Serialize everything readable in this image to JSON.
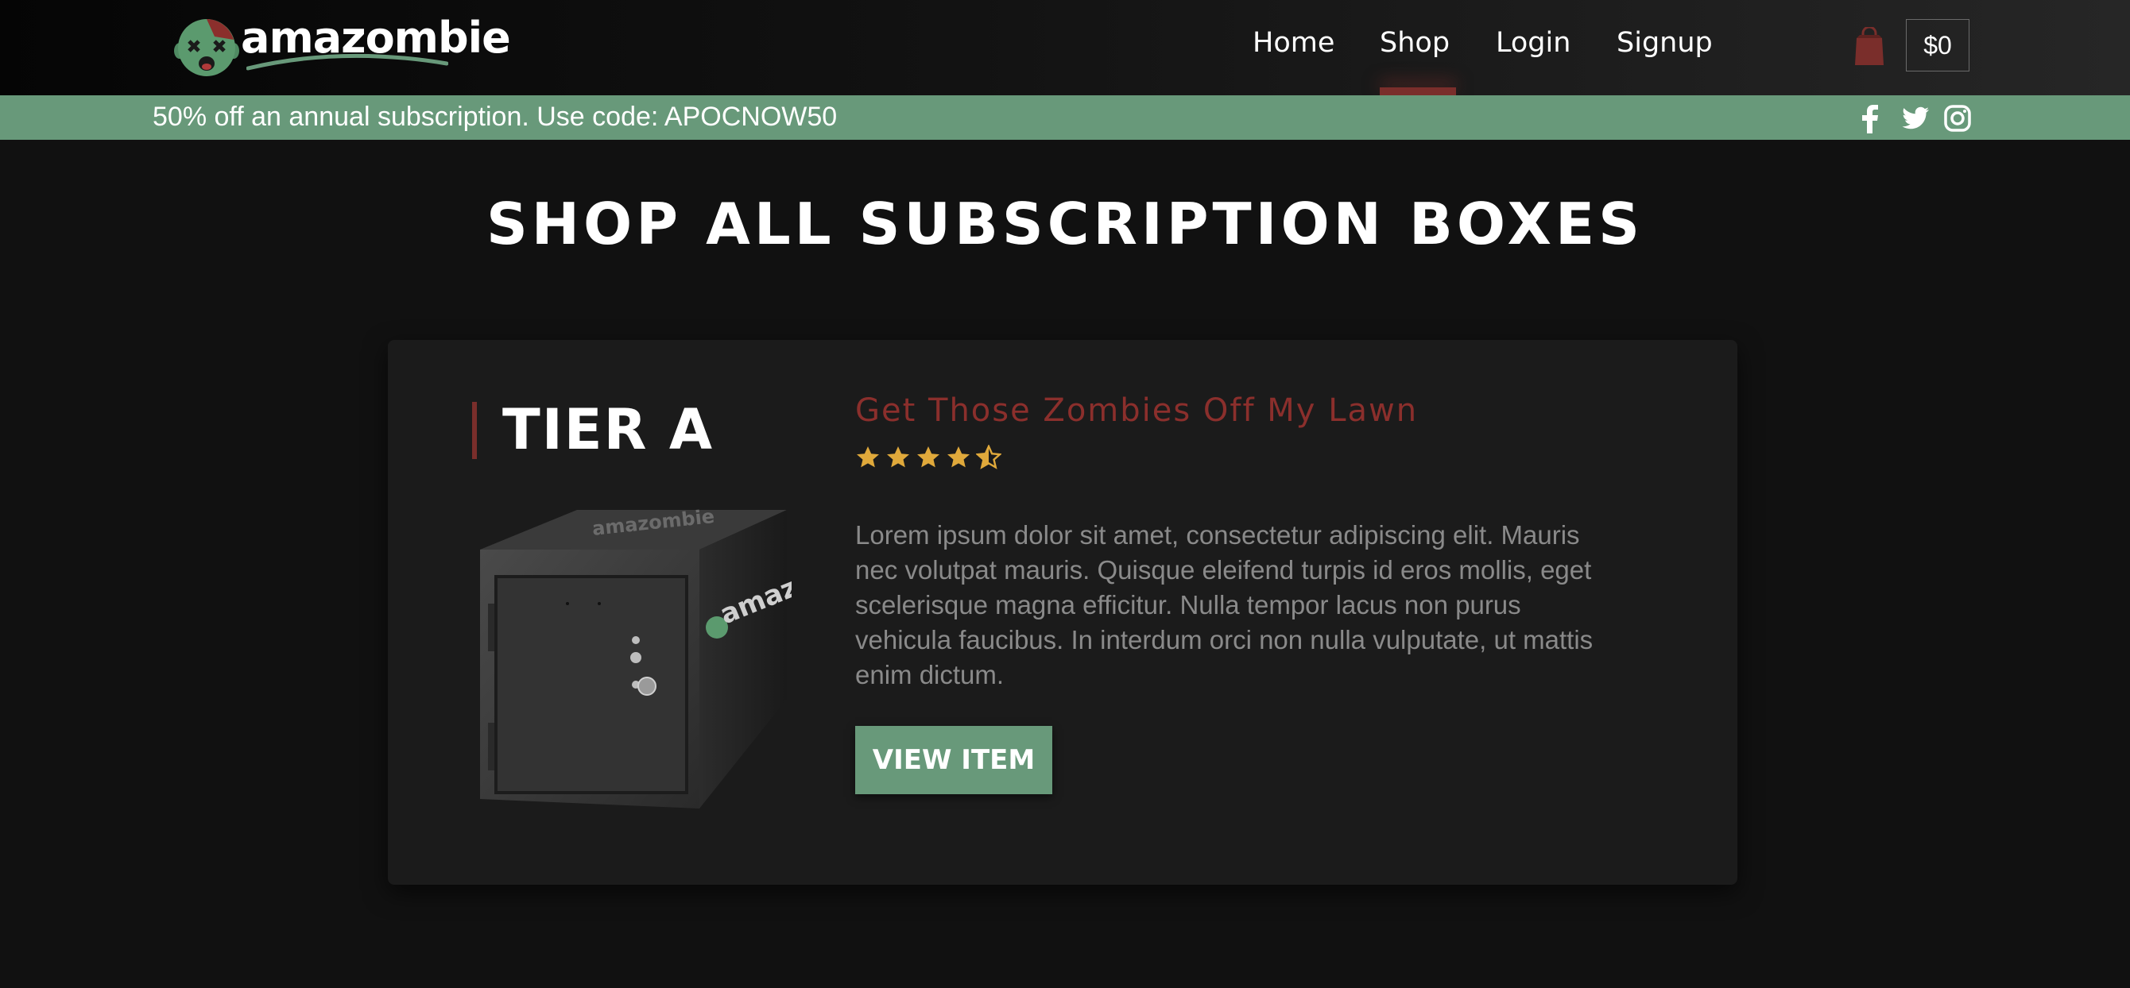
{
  "brand": {
    "name": "amazombie"
  },
  "nav": {
    "items": [
      {
        "label": "Home",
        "active": false
      },
      {
        "label": "Shop",
        "active": true
      },
      {
        "label": "Login",
        "active": false
      },
      {
        "label": "Signup",
        "active": false
      }
    ]
  },
  "cart": {
    "total": "$0",
    "icon": "shopping-bag-icon"
  },
  "promo": {
    "text": "50% off an annual subscription. Use code: APOCNOW50",
    "social_icons": [
      "facebook-icon",
      "twitter-icon",
      "instagram-icon"
    ]
  },
  "page": {
    "title": "SHOP ALL SUBSCRIPTION BOXES"
  },
  "product": {
    "tier": "TIER A",
    "title": "Get Those Zombies Off My Lawn",
    "rating": 4.5,
    "rating_max": 5,
    "description": "Lorem ipsum dolor sit amet, consectetur adipiscing elit. Mauris nec volutpat mauris. Quisque eleifend turpis id eros mollis, eget scelerisque magna efficitur. Nulla tempor lacus non purus vehicula faucibus. In interdum orci non nulla vulputate, ut mattis enim dictum.",
    "button_label": "VIEW ITEM",
    "box_label": "amazombie"
  },
  "colors": {
    "accent_green": "#68997a",
    "accent_red": "#7a2e2b",
    "star": "#e0a93b"
  }
}
